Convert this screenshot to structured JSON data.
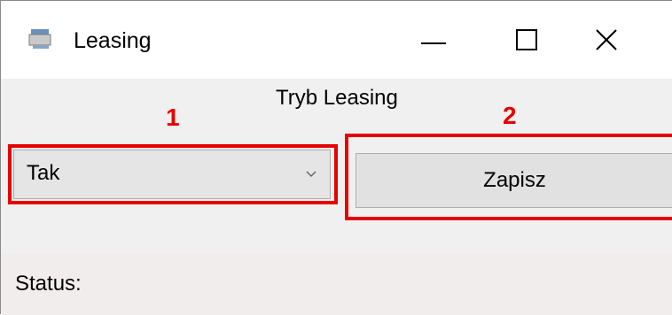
{
  "window": {
    "title": "Leasing",
    "icon": "app-icon"
  },
  "controls": {
    "minimize_icon": "minimize-icon",
    "maximize_icon": "maximize-icon",
    "close_icon": "close-icon"
  },
  "main": {
    "mode_label": "Tryb Leasing",
    "combo_value": "Tak",
    "save_label": "Zapisz"
  },
  "annotations": {
    "marker_1": "1",
    "marker_2": "2",
    "highlight_color": "#e60000"
  },
  "status": {
    "label": "Status:"
  }
}
